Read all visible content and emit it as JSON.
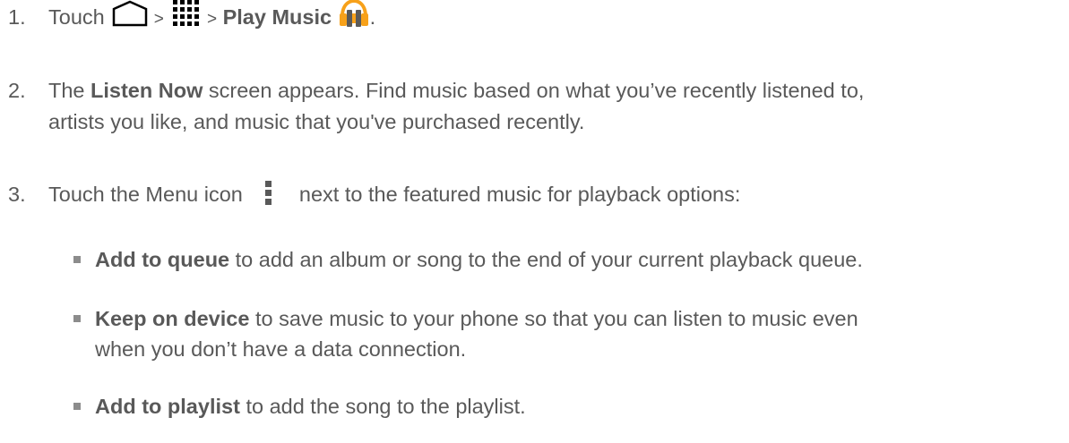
{
  "steps": [
    {
      "number": "1.",
      "parts": {
        "touch": "Touch",
        "sep1": ">",
        "sep2": ">",
        "app_label": "Play Music",
        "end": "."
      }
    },
    {
      "number": "2.",
      "parts": {
        "pre": "The",
        "bold": "Listen Now",
        "post_line1": "screen appears. Find music based on what you’ve recently listened to,",
        "line2": "artists you like, and music that you've purchased recently."
      }
    },
    {
      "number": "3.",
      "parts": {
        "pre": "Touch the Menu icon",
        "post": "next to the featured music for playback options:"
      }
    }
  ],
  "options": [
    {
      "label": "Add to queue",
      "text_line1": "to add an album or song to the end of your current playback queue.",
      "text_line2": ""
    },
    {
      "label": "Keep on device",
      "text_line1": "to save music to your phone so that you can listen to music even",
      "text_line2": "when you don’t have a data connection."
    },
    {
      "label": "Add to playlist",
      "text_line1": "to add the song to the playlist.",
      "text_line2": ""
    }
  ],
  "icons": {
    "home": "home-icon",
    "apps": "apps-grid-icon",
    "play_music": "play-music-headphones-icon",
    "menu": "menu-dots-icon"
  },
  "colors": {
    "text": "#595959",
    "bullet": "#8c8c8c",
    "headphones_orange": "#f7a11a",
    "headphones_dark": "#5a5a5a"
  }
}
